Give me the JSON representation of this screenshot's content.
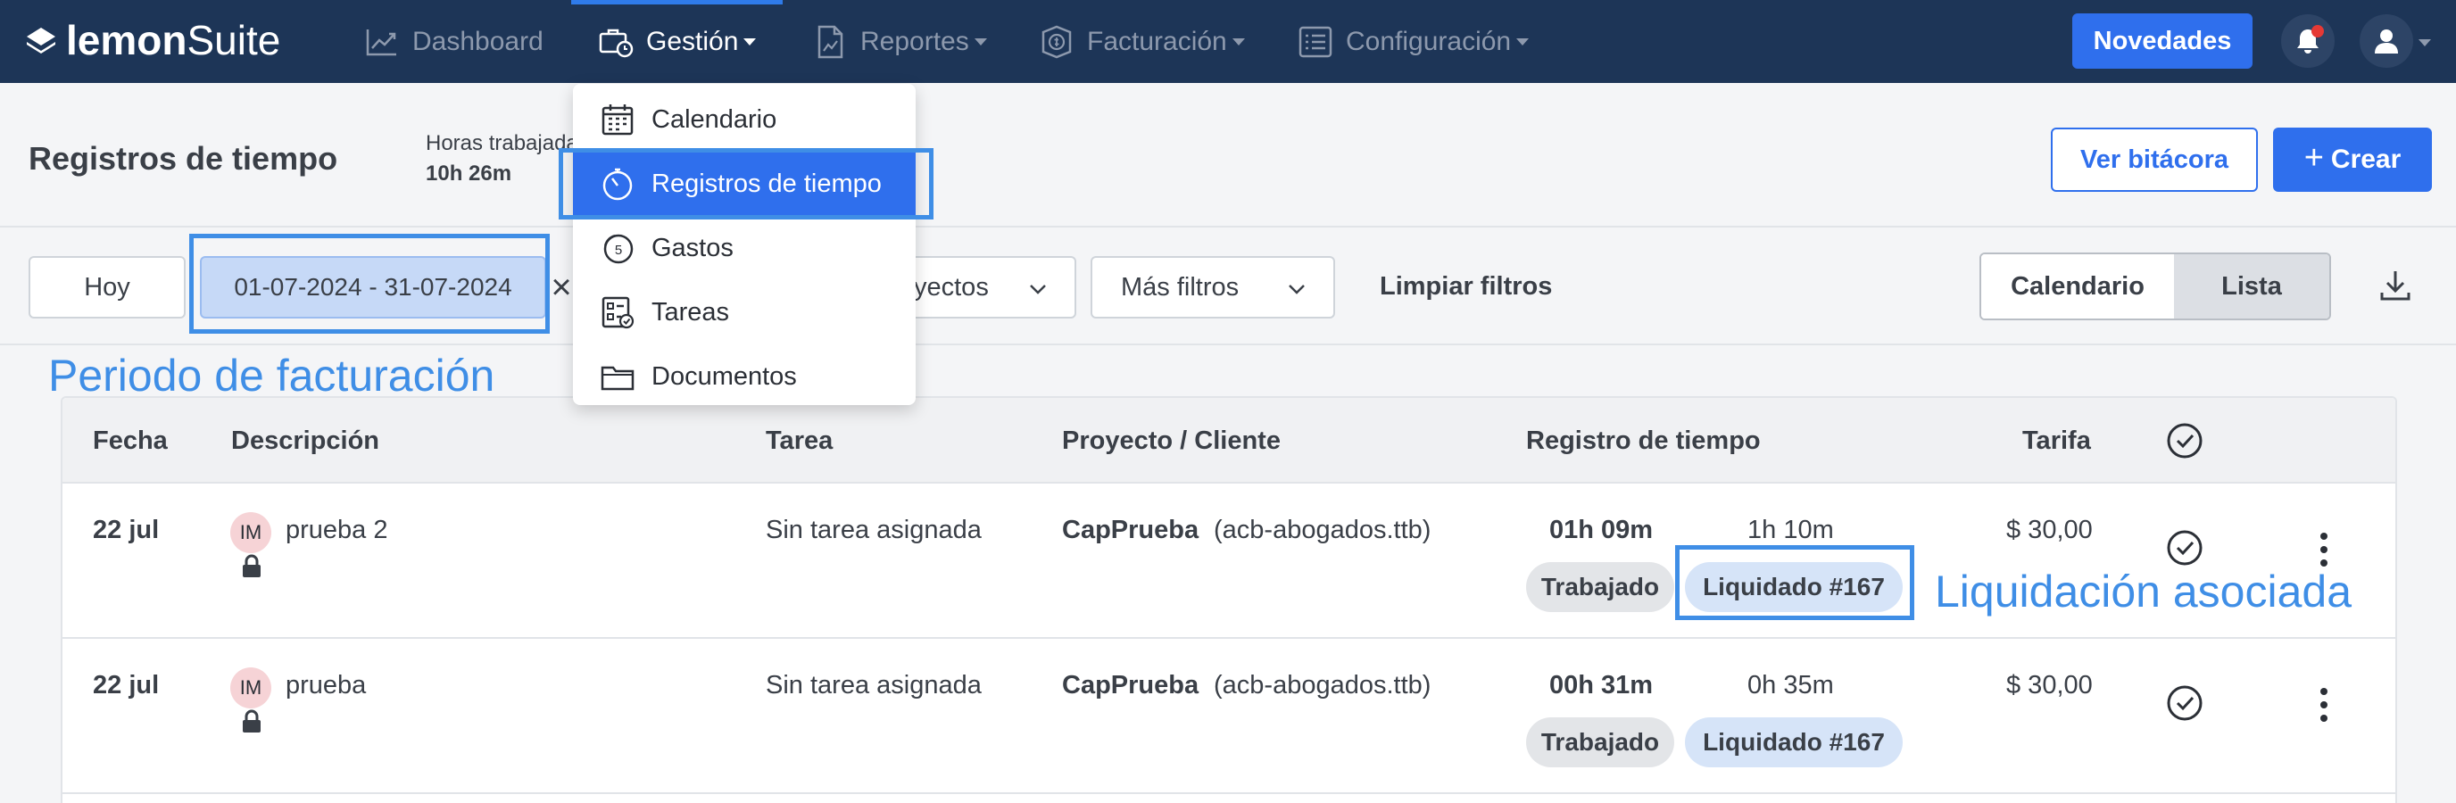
{
  "brand": {
    "name_bold": "lemon",
    "name_regular": "Suite"
  },
  "nav": {
    "dashboard": "Dashboard",
    "gestion": "Gestión",
    "reportes": "Reportes",
    "facturacion": "Facturación",
    "configuracion": "Configuración"
  },
  "topbar": {
    "novedades": "Novedades"
  },
  "header": {
    "title": "Registros de tiempo",
    "hours_label": "Horas trabajadas",
    "hours_value": "10h 26m",
    "ver_bitacora": "Ver bitácora",
    "crear": "Crear"
  },
  "filters": {
    "hoy": "Hoy",
    "date_range": "01-07-2024 - 31-07-2024",
    "clear_symbol": "×",
    "proyectos": "yectos",
    "mas_filtros": "Más filtros",
    "limpiar": "Limpiar filtros",
    "view_calendario": "Calendario",
    "view_lista": "Lista"
  },
  "dropdown": {
    "items": [
      {
        "label": "Calendario",
        "icon": "calendar-icon"
      },
      {
        "label": "Registros de tiempo",
        "icon": "stopwatch-icon",
        "selected": true
      },
      {
        "label": "Gastos",
        "icon": "coin-icon"
      },
      {
        "label": "Tareas",
        "icon": "tasks-icon"
      },
      {
        "label": "Documentos",
        "icon": "folder-icon"
      }
    ]
  },
  "annotations": {
    "periodo": "Periodo de facturación",
    "liquidacion": "Liquidación asociada"
  },
  "table": {
    "headers": {
      "fecha": "Fecha",
      "descripcion": "Descripción",
      "tarea": "Tarea",
      "proyecto": "Proyecto / Cliente",
      "registro": "Registro de tiempo",
      "tarifa": "Tarifa"
    },
    "rows": [
      {
        "fecha": "22 jul",
        "avatar": "IM",
        "descripcion": "prueba 2",
        "tarea": "Sin tarea asignada",
        "proyecto": "CapPrueba",
        "cliente": "(acb-abogados.ttb)",
        "tiempo": "01h 09m",
        "tiempo_facturable": "1h 10m",
        "estado": "Trabajado",
        "liquidacion": "Liquidado #167",
        "tarifa": "$ 30,00"
      },
      {
        "fecha": "22 jul",
        "avatar": "IM",
        "descripcion": "prueba",
        "tarea": "Sin tarea asignada",
        "proyecto": "CapPrueba",
        "cliente": "(acb-abogados.ttb)",
        "tiempo": "00h 31m",
        "tiempo_facturable": "0h 35m",
        "estado": "Trabajado",
        "liquidacion": "Liquidado #167",
        "tarifa": "$ 30,00"
      }
    ]
  },
  "colors": {
    "nav_bg": "#1d3557",
    "primary": "#2f6fed",
    "annotation": "#3f8ee6",
    "notification": "#e53935"
  }
}
